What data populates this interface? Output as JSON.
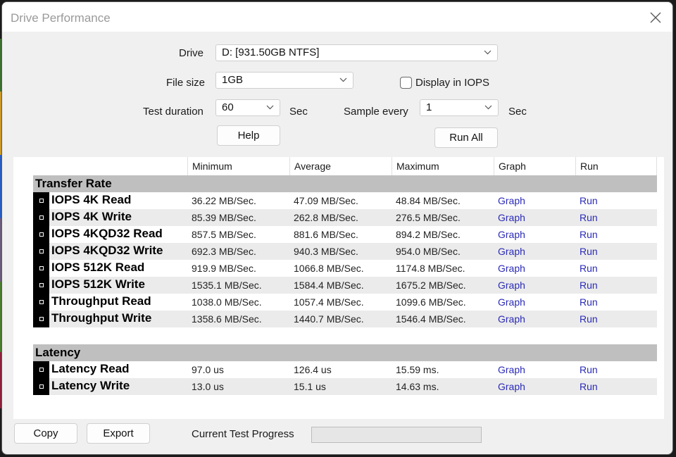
{
  "window": {
    "title": "Drive Performance",
    "close_icon": "close-icon"
  },
  "settings": {
    "drive_label": "Drive",
    "drive_value": "D: [931.50GB NTFS]",
    "file_size_label": "File size",
    "file_size_value": "1GB",
    "display_iops_label": "Display in IOPS",
    "display_iops_checked": false,
    "test_duration_label": "Test duration",
    "test_duration_value": "60",
    "test_duration_unit": "Sec",
    "sample_every_label": "Sample every",
    "sample_every_value": "1",
    "sample_every_unit": "Sec",
    "help_label": "Help",
    "run_all_label": "Run All"
  },
  "table": {
    "columns": [
      "Minimum",
      "Average",
      "Maximum",
      "Graph",
      "Run"
    ],
    "sections": [
      {
        "title": "Transfer Rate",
        "rows": [
          {
            "name": "IOPS 4K Read",
            "min": "36.22 MB/Sec.",
            "avg": "47.09 MB/Sec.",
            "max": "48.84 MB/Sec.",
            "graph": "Graph",
            "run": "Run"
          },
          {
            "name": "IOPS 4K Write",
            "min": "85.39 MB/Sec.",
            "avg": "262.8 MB/Sec.",
            "max": "276.5 MB/Sec.",
            "graph": "Graph",
            "run": "Run"
          },
          {
            "name": "IOPS 4KQD32 Read",
            "min": "857.5 MB/Sec.",
            "avg": "881.6 MB/Sec.",
            "max": "894.2 MB/Sec.",
            "graph": "Graph",
            "run": "Run"
          },
          {
            "name": "IOPS 4KQD32 Write",
            "min": "692.3 MB/Sec.",
            "avg": "940.3 MB/Sec.",
            "max": "954.0 MB/Sec.",
            "graph": "Graph",
            "run": "Run"
          },
          {
            "name": "IOPS 512K Read",
            "min": "919.9 MB/Sec.",
            "avg": "1066.8 MB/Sec.",
            "max": "1174.8 MB/Sec.",
            "graph": "Graph",
            "run": "Run"
          },
          {
            "name": "IOPS 512K Write",
            "min": "1535.1 MB/Sec.",
            "avg": "1584.4 MB/Sec.",
            "max": "1675.2 MB/Sec.",
            "graph": "Graph",
            "run": "Run"
          },
          {
            "name": "Throughput Read",
            "min": "1038.0 MB/Sec.",
            "avg": "1057.4 MB/Sec.",
            "max": "1099.6 MB/Sec.",
            "graph": "Graph",
            "run": "Run"
          },
          {
            "name": "Throughput Write",
            "min": "1358.6 MB/Sec.",
            "avg": "1440.7 MB/Sec.",
            "max": "1546.4 MB/Sec.",
            "graph": "Graph",
            "run": "Run"
          }
        ]
      },
      {
        "title": "Latency",
        "rows": [
          {
            "name": "Latency Read",
            "min": "97.0 us",
            "avg": "126.4 us",
            "max": "15.59 ms.",
            "graph": "Graph",
            "run": "Run"
          },
          {
            "name": "Latency Write",
            "min": "13.0 us",
            "avg": "15.1 us",
            "max": "14.63 ms.",
            "graph": "Graph",
            "run": "Run"
          }
        ]
      }
    ]
  },
  "footer": {
    "copy_label": "Copy",
    "export_label": "Export",
    "progress_label": "Current Test Progress",
    "progress_value": 0
  },
  "colors": {
    "link": "#2a2ab8",
    "section_bg": "#bfbfbf",
    "alt_row_bg": "#ebebeb",
    "badge_bg": "#000000"
  }
}
